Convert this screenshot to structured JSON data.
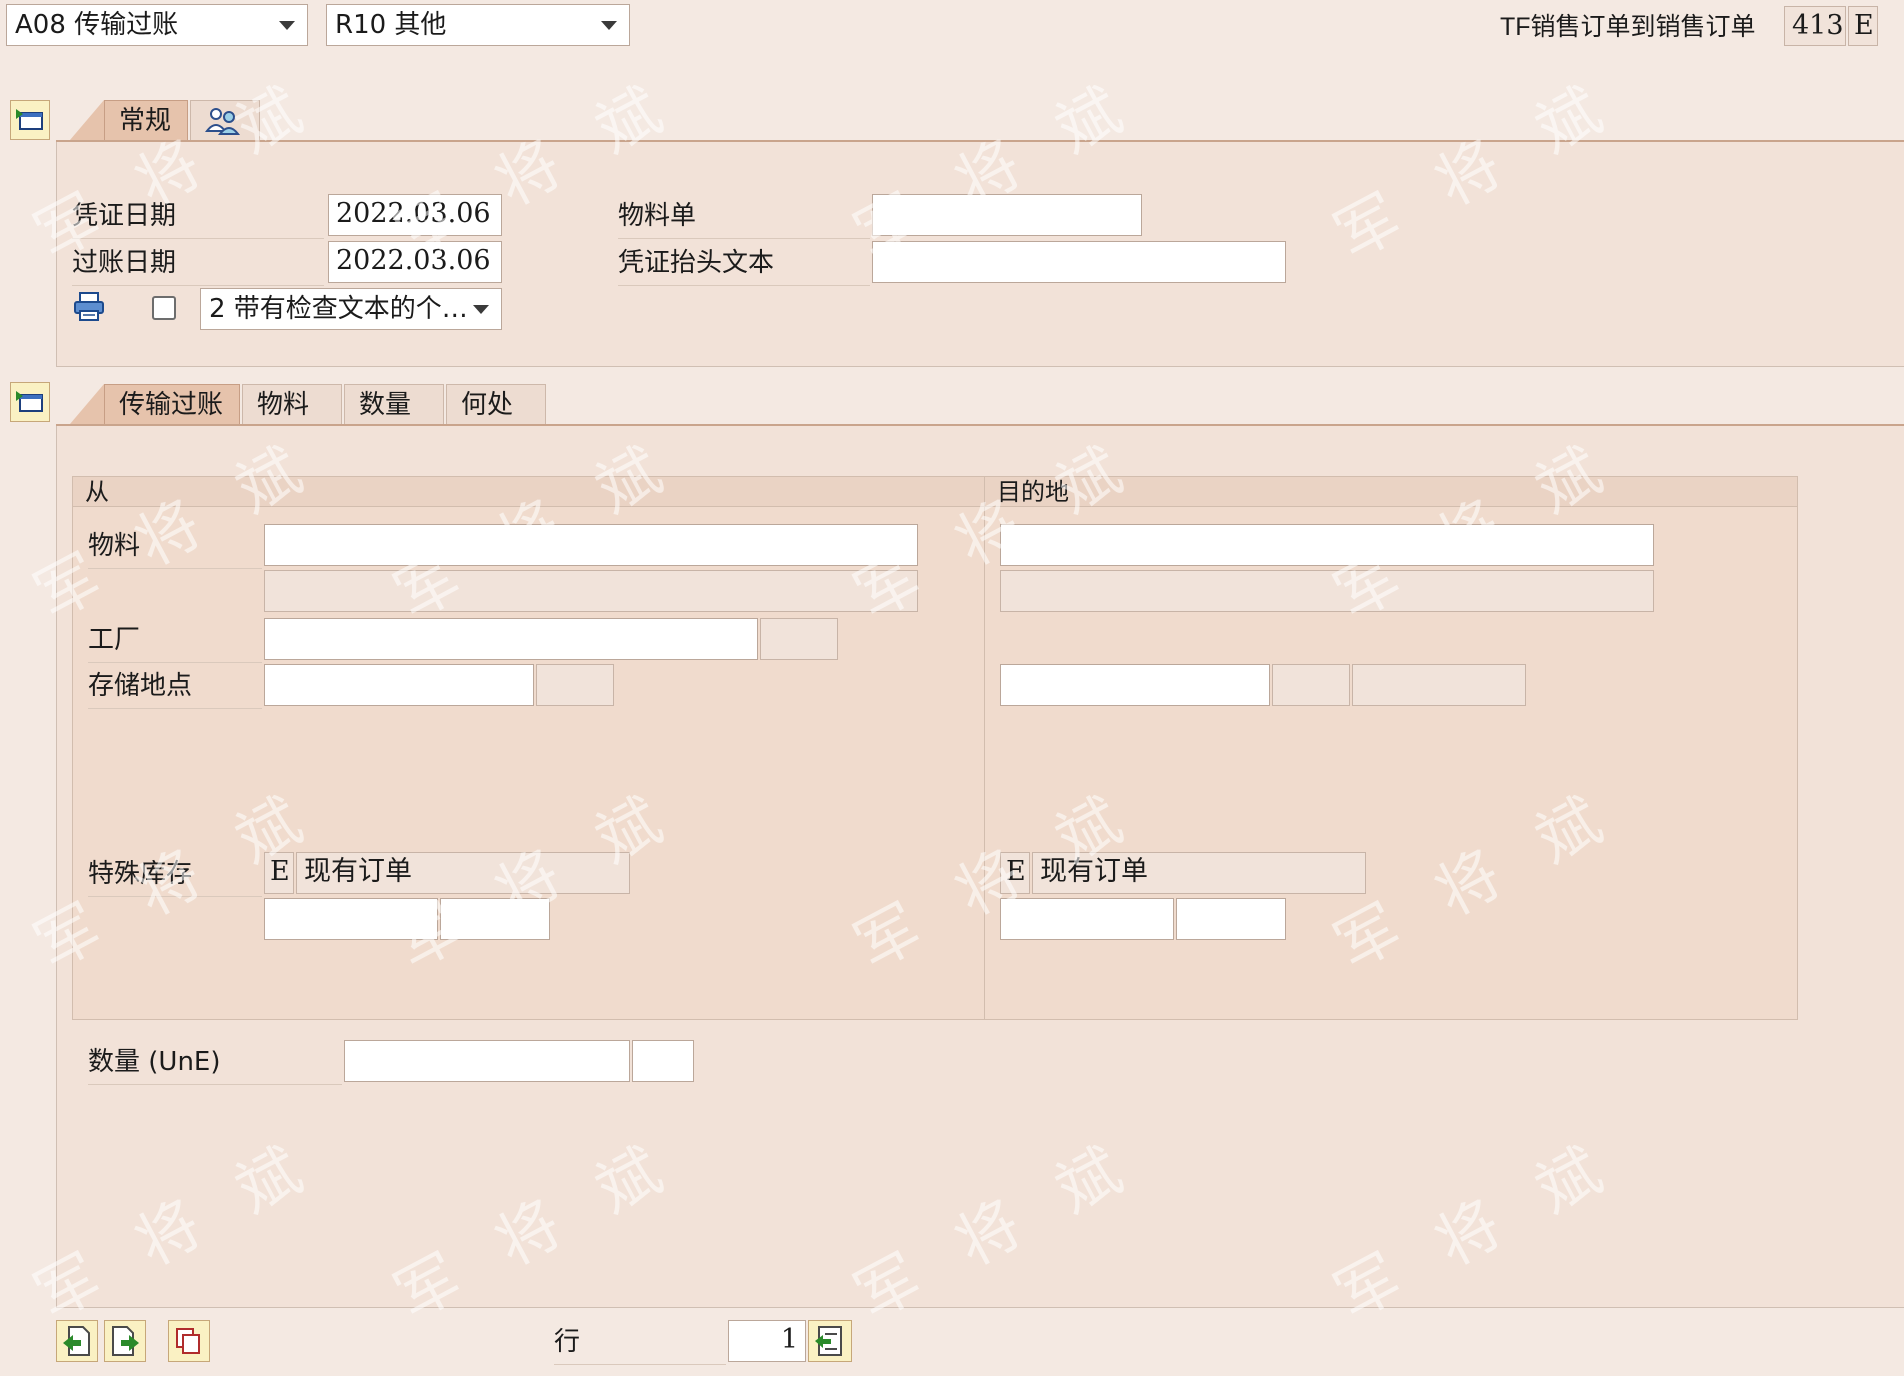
{
  "header": {
    "action_select": "A08 传输过账",
    "reason_select": "R10 其他",
    "movement_title": "TF销售订单到销售订单",
    "movement_type": "413",
    "special_stock": "E"
  },
  "top_tabs": {
    "general": "常规"
  },
  "general": {
    "doc_date_label": "凭证日期",
    "doc_date": "2022.03.06",
    "posting_date_label": "过账日期",
    "posting_date": "2022.03.06",
    "bill_of_lading_label": "物料单",
    "bill_of_lading": "",
    "header_text_label": "凭证抬头文本",
    "header_text": "",
    "print_version": "2 带有检查文本的个…"
  },
  "detail_tabs": {
    "transfer": "传输过账",
    "material": "物料",
    "quantity": "数量",
    "where": "何处"
  },
  "from": {
    "heading": "从",
    "material_label": "物料",
    "plant_label": "工厂",
    "sloc_label": "存储地点",
    "special_stock_label": "特殊库存",
    "special_stock_code": "E",
    "special_stock_text": "现有订单"
  },
  "to": {
    "heading": "目的地",
    "special_stock_code": "E",
    "special_stock_text": "现有订单"
  },
  "quantity": {
    "label": "数量 (UnE)",
    "value": "",
    "unit": ""
  },
  "footer": {
    "line_label": "行",
    "line_value": "1"
  },
  "watermark": "军 将 斌"
}
